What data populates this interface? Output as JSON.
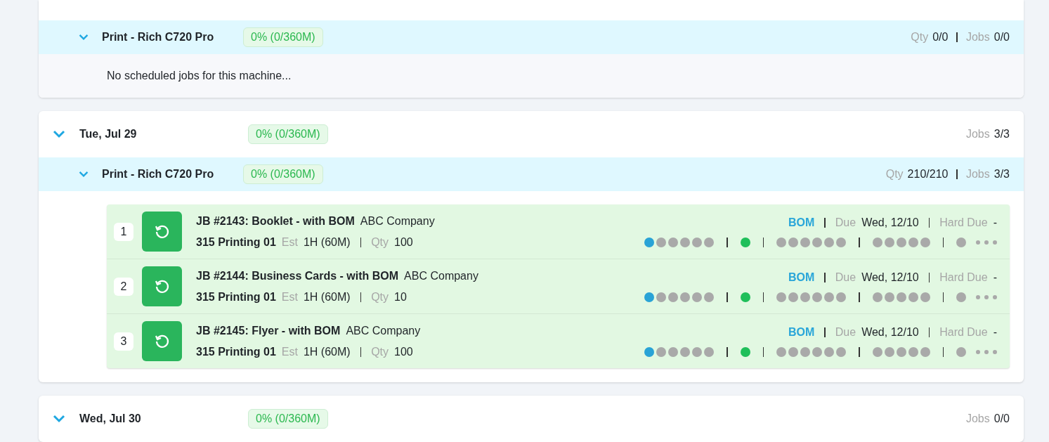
{
  "days": [
    {
      "machines": [
        {
          "name": "Print - Rich C720 Pro",
          "expanded": true,
          "badge": "0% (0/360M)",
          "qty_label": "Qty",
          "qty": "0/0",
          "jobs_label": "Jobs",
          "jobs": "0/0",
          "empty_text": "No scheduled jobs for this machine..."
        }
      ]
    },
    {
      "date": "Tue, Jul 29",
      "expanded": true,
      "badge": "0% (0/360M)",
      "jobs_label": "Jobs",
      "jobs": "3/3",
      "machines": [
        {
          "name": "Print - Rich C720 Pro",
          "expanded": true,
          "badge": "0% (0/360M)",
          "qty_label": "Qty",
          "qty": "210/210",
          "jobs_label": "Jobs",
          "jobs": "3/3",
          "jobs_list": [
            {
              "number": "1",
              "title": "JB #2143: Booklet - with BOM",
              "company": "ABC Company",
              "machine": "315 Printing 01",
              "est_label": "Est",
              "est": "1H (60M)",
              "qty_label": "Qty",
              "qty": "100",
              "bom": "BOM",
              "due_label": "Due",
              "due": "Wed, 12/10",
              "hard_due_label": "Hard Due",
              "hard_due": "-",
              "stages": [
                [
                  {
                    "color": "#29a3d6"
                  },
                  {
                    "color": "#a9a9a9"
                  },
                  {
                    "color": "#a9a9a9"
                  },
                  {
                    "color": "#a9a9a9"
                  },
                  {
                    "color": "#a9a9a9"
                  },
                  {
                    "color": "#a9a9a9"
                  }
                ],
                [
                  {
                    "color": "#1fbf5a"
                  }
                ],
                [
                  {
                    "color": "#a9a9a9"
                  },
                  {
                    "color": "#a9a9a9"
                  },
                  {
                    "color": "#a9a9a9"
                  },
                  {
                    "color": "#a9a9a9"
                  },
                  {
                    "color": "#a9a9a9"
                  },
                  {
                    "color": "#a9a9a9"
                  }
                ],
                [
                  {
                    "color": "#a9a9a9"
                  },
                  {
                    "color": "#a9a9a9"
                  },
                  {
                    "color": "#a9a9a9"
                  },
                  {
                    "color": "#a9a9a9"
                  },
                  {
                    "color": "#a9a9a9"
                  }
                ],
                [
                  {
                    "color": "#a9a9a9"
                  }
                ]
              ]
            },
            {
              "number": "2",
              "title": "JB #2144: Business Cards - with BOM",
              "company": "ABC Company",
              "machine": "315 Printing 01",
              "est_label": "Est",
              "est": "1H (60M)",
              "qty_label": "Qty",
              "qty": "10",
              "bom": "BOM",
              "due_label": "Due",
              "due": "Wed, 12/10",
              "hard_due_label": "Hard Due",
              "hard_due": "-",
              "stages": [
                [
                  {
                    "color": "#29a3d6"
                  },
                  {
                    "color": "#a9a9a9"
                  },
                  {
                    "color": "#a9a9a9"
                  },
                  {
                    "color": "#a9a9a9"
                  },
                  {
                    "color": "#a9a9a9"
                  },
                  {
                    "color": "#a9a9a9"
                  }
                ],
                [
                  {
                    "color": "#1fbf5a"
                  }
                ],
                [
                  {
                    "color": "#a9a9a9"
                  },
                  {
                    "color": "#a9a9a9"
                  },
                  {
                    "color": "#a9a9a9"
                  },
                  {
                    "color": "#a9a9a9"
                  },
                  {
                    "color": "#a9a9a9"
                  },
                  {
                    "color": "#a9a9a9"
                  }
                ],
                [
                  {
                    "color": "#a9a9a9"
                  },
                  {
                    "color": "#a9a9a9"
                  },
                  {
                    "color": "#a9a9a9"
                  },
                  {
                    "color": "#a9a9a9"
                  },
                  {
                    "color": "#a9a9a9"
                  }
                ],
                [
                  {
                    "color": "#a9a9a9"
                  }
                ]
              ]
            },
            {
              "number": "3",
              "title": "JB #2145: Flyer - with BOM",
              "company": "ABC Company",
              "machine": "315 Printing 01",
              "est_label": "Est",
              "est": "1H (60M)",
              "qty_label": "Qty",
              "qty": "100",
              "bom": "BOM",
              "due_label": "Due",
              "due": "Wed, 12/10",
              "hard_due_label": "Hard Due",
              "hard_due": "-",
              "stages": [
                [
                  {
                    "color": "#29a3d6"
                  },
                  {
                    "color": "#a9a9a9"
                  },
                  {
                    "color": "#a9a9a9"
                  },
                  {
                    "color": "#a9a9a9"
                  },
                  {
                    "color": "#a9a9a9"
                  },
                  {
                    "color": "#a9a9a9"
                  }
                ],
                [
                  {
                    "color": "#1fbf5a"
                  }
                ],
                [
                  {
                    "color": "#a9a9a9"
                  },
                  {
                    "color": "#a9a9a9"
                  },
                  {
                    "color": "#a9a9a9"
                  },
                  {
                    "color": "#a9a9a9"
                  },
                  {
                    "color": "#a9a9a9"
                  },
                  {
                    "color": "#a9a9a9"
                  }
                ],
                [
                  {
                    "color": "#a9a9a9"
                  },
                  {
                    "color": "#a9a9a9"
                  },
                  {
                    "color": "#a9a9a9"
                  },
                  {
                    "color": "#a9a9a9"
                  },
                  {
                    "color": "#a9a9a9"
                  }
                ],
                [
                  {
                    "color": "#a9a9a9"
                  }
                ]
              ]
            }
          ]
        }
      ]
    },
    {
      "date": "Wed, Jul 30",
      "expanded": true,
      "badge": "0% (0/360M)",
      "jobs_label": "Jobs",
      "jobs": "0/0"
    }
  ]
}
